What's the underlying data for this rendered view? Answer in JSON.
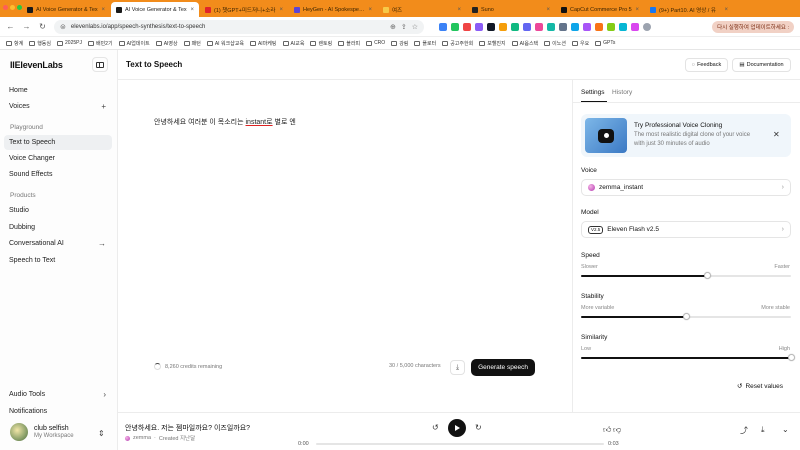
{
  "browser": {
    "tabs": [
      {
        "title": "AI Voice Generator & Tex",
        "color": "#1a1a1a",
        "active": false
      },
      {
        "title": "AI Voice Generator & Tex",
        "color": "#1a1a1a",
        "active": true
      },
      {
        "title": "(1) 챗GPT+미드저니+소라",
        "color": "#e0242a",
        "active": false
      },
      {
        "title": "HeyGen - AI Spokesperso",
        "color": "#5b45d6",
        "active": false
      },
      {
        "title": "여즈",
        "color": "#f7c948",
        "active": false
      },
      {
        "title": "Suno",
        "color": "#222222",
        "active": false
      },
      {
        "title": "CapCut Commerce Pro 5",
        "color": "#111111",
        "active": false
      },
      {
        "title": "(9+) Part10. AI 영상 / 유",
        "color": "#1877f2",
        "active": false
      }
    ],
    "url": "elevenlabs.io/app/speech-synthesis/text-to-speech",
    "update_label": "다시 실행하여 업데이트하세요 :",
    "bookmarks": [
      "항계",
      "행동심",
      "2025PJ",
      "배민2기",
      "AI업데이트",
      "AI영상",
      "패턴",
      "AI 워크샵교육",
      "AI마케팅",
      "AI교육",
      "렌토링",
      "블라피",
      "CRO",
      "강림",
      "플로터",
      "공고주한회",
      "보헬진지",
      "AI옵스택",
      "이노션",
      "우요",
      "GPTs"
    ]
  },
  "sidebar": {
    "brand": "IIElevenLabs",
    "primary": [
      {
        "label": "Home",
        "trail": ""
      },
      {
        "label": "Voices",
        "trail": "+"
      }
    ],
    "playground_label": "Playground",
    "playground": [
      {
        "label": "Text to Speech",
        "trail": ""
      },
      {
        "label": "Voice Changer",
        "trail": ""
      },
      {
        "label": "Sound Effects",
        "trail": ""
      }
    ],
    "products_label": "Products",
    "products": [
      {
        "label": "Studio",
        "trail": ""
      },
      {
        "label": "Dubbing",
        "trail": ""
      },
      {
        "label": "Conversational AI",
        "trail": "→"
      },
      {
        "label": "Speech to Text",
        "trail": ""
      }
    ],
    "bottom": [
      {
        "label": "Audio Tools",
        "trail": "›"
      },
      {
        "label": "Notifications",
        "trail": ""
      }
    ],
    "user": {
      "name": "club selfish",
      "workspace": "My Workspace"
    }
  },
  "main": {
    "title": "Text to Speech",
    "text_before": "안녕하세요 여러분 이 목소리는 ",
    "text_underlined": "instant로",
    "text_after": " 별로 엔",
    "credits": "8,260 credits remaining",
    "char_count": "30 / 5,000 characters",
    "generate_label": "Generate speech"
  },
  "header": {
    "feedback": "Feedback",
    "documentation": "Documentation"
  },
  "panel": {
    "tabs": [
      "Settings",
      "History"
    ],
    "promo": {
      "title": "Try Professional Voice Cloning",
      "desc": "The most realistic digital clone of your voice with just 30 minutes of audio"
    },
    "voice_label": "Voice",
    "voice_value": "zemma_instant",
    "model_label": "Model",
    "model_badge": "V2.5",
    "model_value": "Eleven Flash v2.5",
    "speed": {
      "label": "Speed",
      "min": "Slower",
      "max": "Faster",
      "value": 0.6
    },
    "stability": {
      "label": "Stability",
      "min": "More variable",
      "max": "More stable",
      "value": 0.5
    },
    "similarity": {
      "label": "Similarity",
      "min": "Low",
      "max": "High",
      "value": 1.0
    },
    "reset_label": "Reset values"
  },
  "player": {
    "title": "안녕하세요. 저는 젬마일까요? 이즈일까요?",
    "voice": "zemma",
    "created": "Created 지난달",
    "time_current": "0:00",
    "time_total": "0:03",
    "progress": 0.0
  }
}
